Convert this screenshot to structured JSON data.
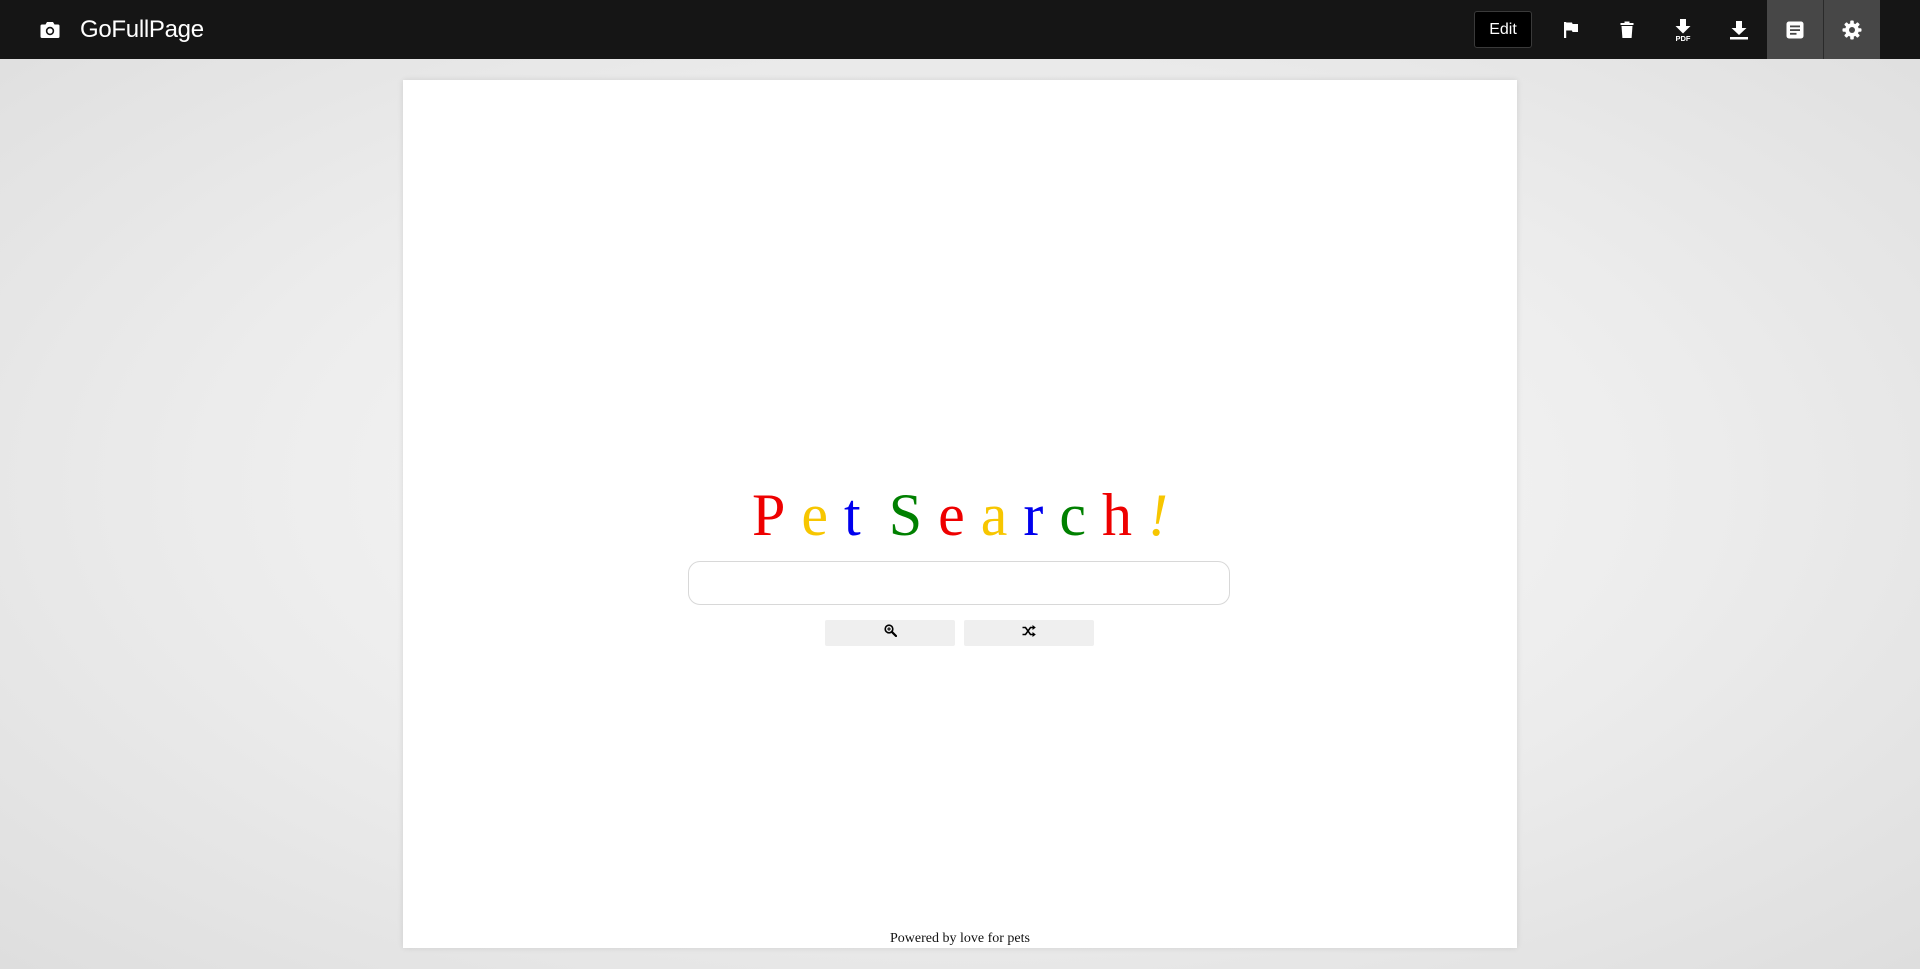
{
  "app": {
    "title": "GoFullPage",
    "icon": "camera-icon"
  },
  "toolbar": {
    "edit_label": "Edit",
    "buttons": [
      {
        "name": "flag-icon"
      },
      {
        "name": "trash-icon"
      },
      {
        "name": "download-pdf-icon",
        "badge": "PDF"
      },
      {
        "name": "download-icon"
      },
      {
        "name": "document-icon",
        "active": true
      },
      {
        "name": "gear-icon",
        "active": true
      }
    ]
  },
  "page": {
    "logo": {
      "letters": [
        {
          "char": "P",
          "color": "#ee0000"
        },
        {
          "char": "e",
          "color": "#f7c600"
        },
        {
          "char": "t",
          "color": "#0000ee"
        },
        {
          "char": "S",
          "color": "#008000"
        },
        {
          "char": "e",
          "color": "#ee0000"
        },
        {
          "char": "a",
          "color": "#f7c600"
        },
        {
          "char": "r",
          "color": "#0000ee"
        },
        {
          "char": "c",
          "color": "#008000"
        },
        {
          "char": "h",
          "color": "#ee0000"
        },
        {
          "char": "!",
          "color": "#f7c600"
        }
      ]
    },
    "search": {
      "value": "",
      "placeholder": ""
    },
    "buttons": {
      "search_icon": "magnifier-icon",
      "random_icon": "shuffle-icon"
    },
    "footer": "Powered by love for pets"
  }
}
